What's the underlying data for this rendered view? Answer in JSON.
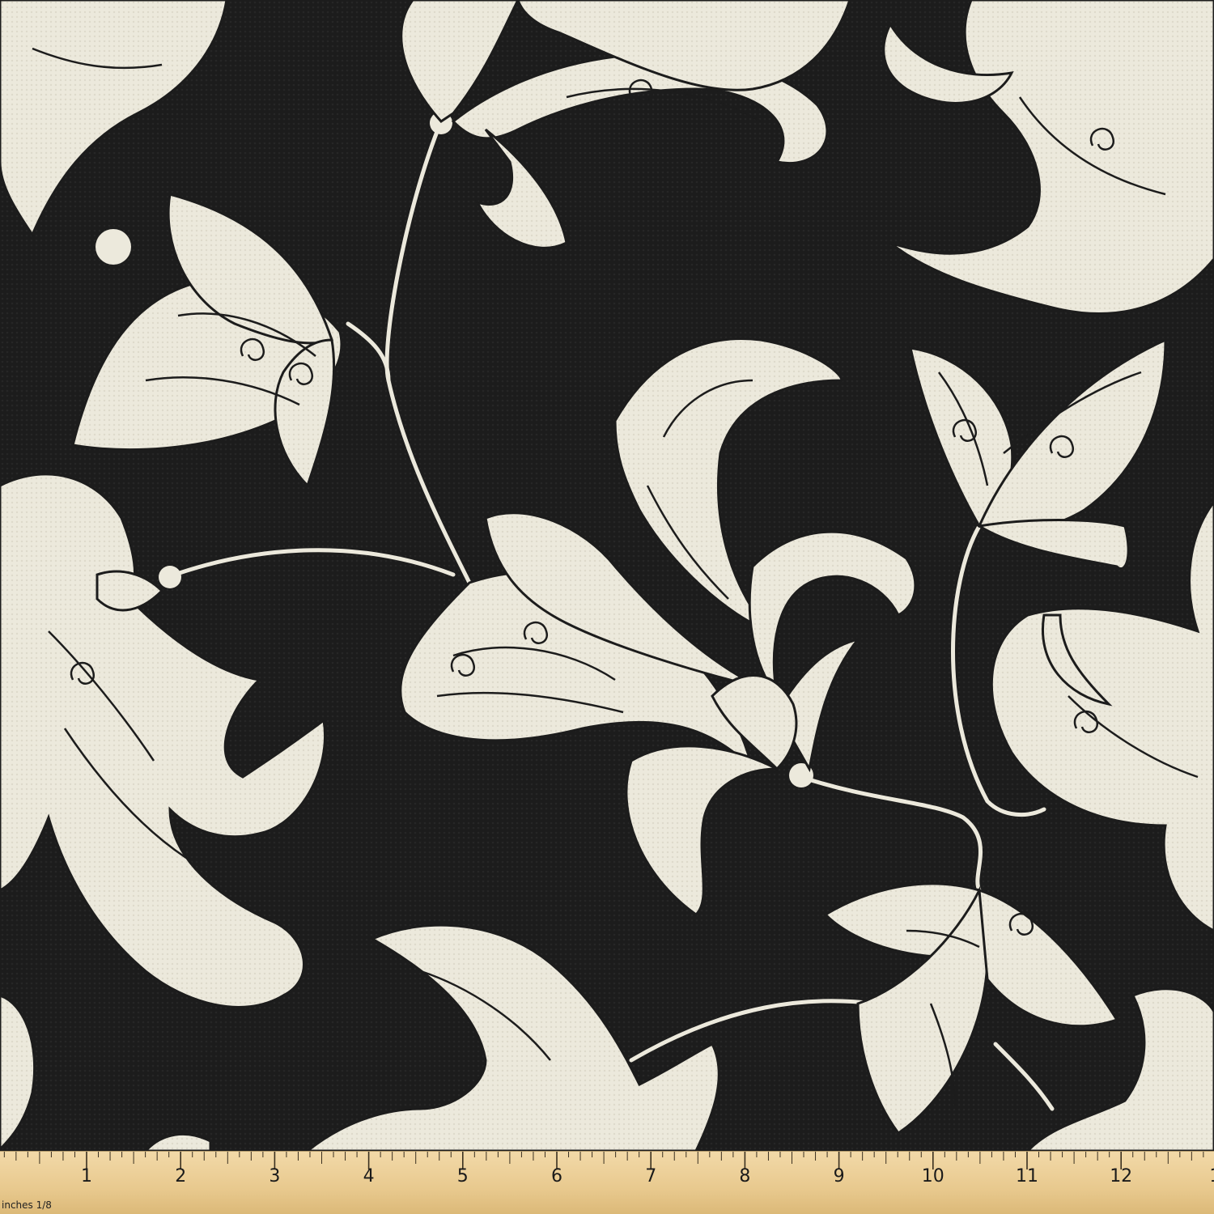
{
  "colors": {
    "background": "#1c1c1c",
    "motif": "#ece9dc",
    "outline": "#1c1c1c",
    "ruler": "#e8c98e"
  },
  "ruler": {
    "unit_label": "inches",
    "fraction_label": "1/8",
    "numbers": [
      "1",
      "2",
      "3",
      "4",
      "5",
      "6",
      "7",
      "8",
      "9",
      "10",
      "11",
      "12",
      "1"
    ]
  }
}
